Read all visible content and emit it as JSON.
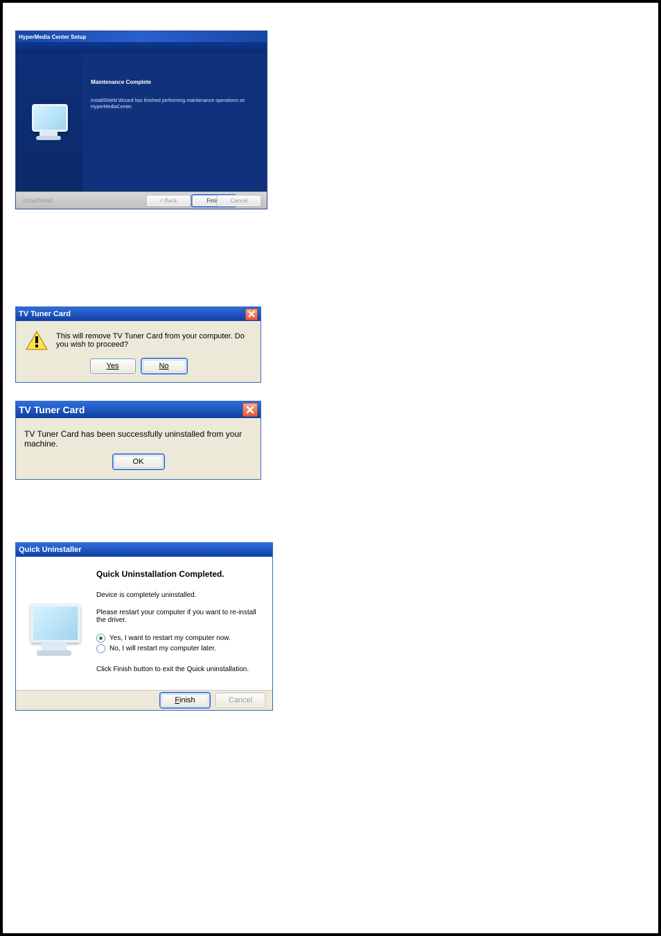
{
  "dialog1": {
    "title": "HyperMedia Center Setup",
    "heading": "Maintenance Complete",
    "text": "InstallShield Wizard has finished performing maintenance operations on HyperMediaCenter.",
    "brand": "InstallShield",
    "buttons": {
      "back": "< Back",
      "finish": "Finish",
      "cancel": "Cancel"
    }
  },
  "dialog2": {
    "title": "TV Tuner Card",
    "text": "This will remove TV Tuner Card from your computer. Do you wish to proceed?",
    "buttons": {
      "yes": "Yes",
      "no": "No"
    }
  },
  "dialog3": {
    "title": "TV Tuner Card",
    "text": "TV Tuner Card has been successfully uninstalled from your machine.",
    "buttons": {
      "ok": "OK"
    }
  },
  "dialog4": {
    "title": "Quick Uninstaller",
    "heading": "Quick Uninstallation Completed.",
    "line1": "Device is completely uninstalled.",
    "line2": "Please restart your computer if you want to re-install the driver.",
    "opt_yes": "Yes, I want to restart my computer now.",
    "opt_no": "No, I will restart my computer later.",
    "line3": "Click Finish button to exit the Quick uninstallation.",
    "buttons": {
      "finish": "Finish",
      "cancel": "Cancel"
    }
  }
}
